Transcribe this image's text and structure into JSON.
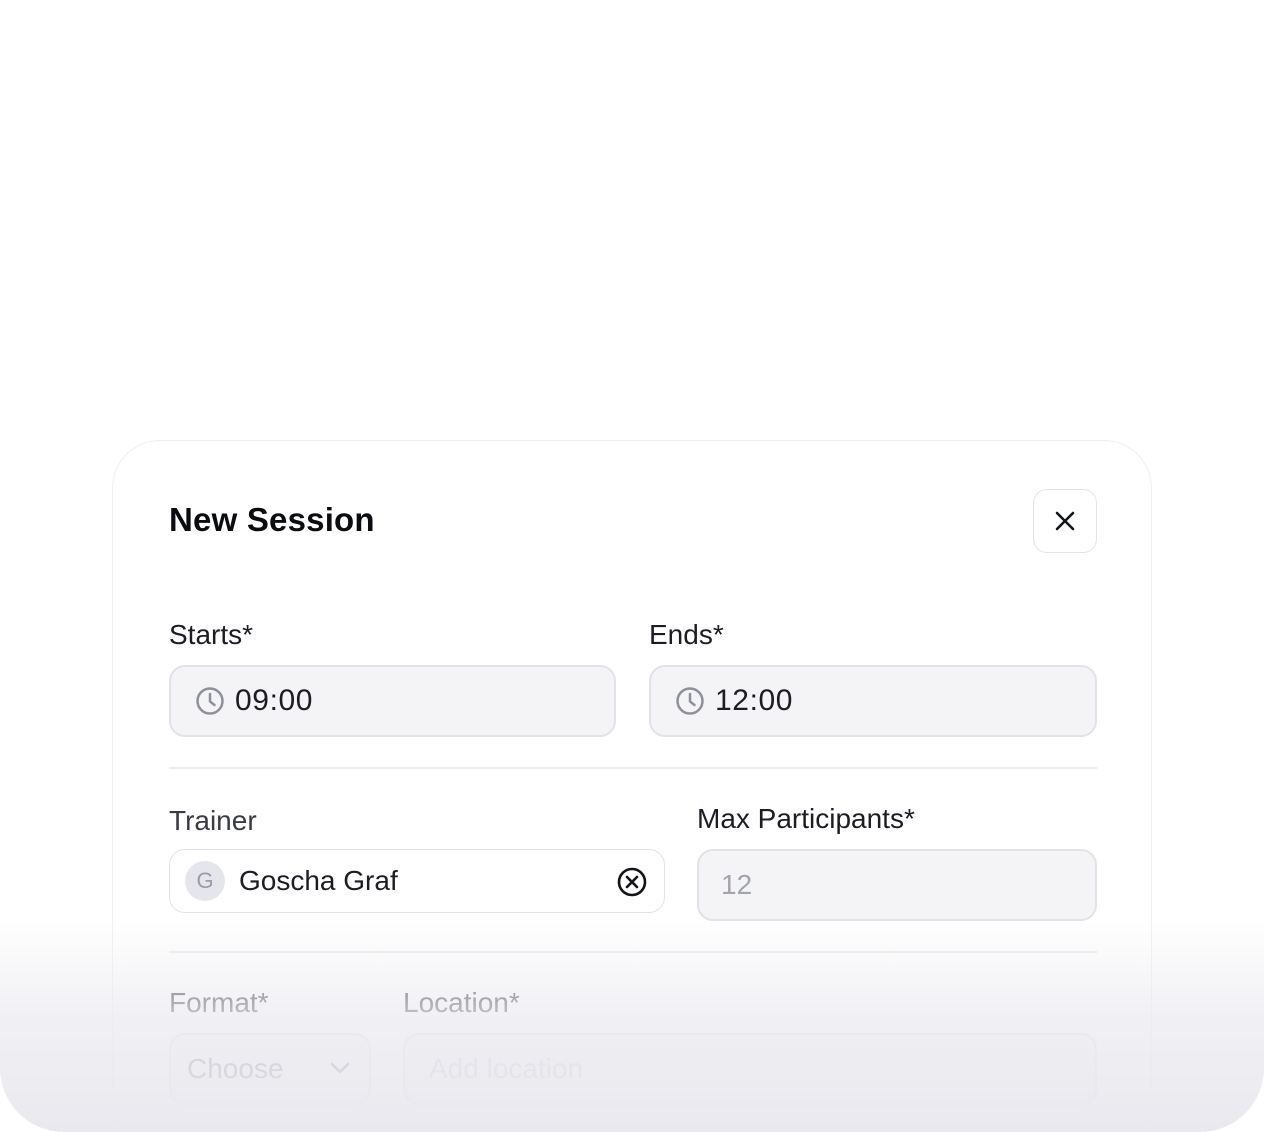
{
  "modal": {
    "title": "New Session",
    "close_icon": "close-icon"
  },
  "fields": {
    "starts": {
      "label": "Starts*",
      "value": "09:00",
      "icon": "clock-icon"
    },
    "ends": {
      "label": "Ends*",
      "value": "12:00",
      "icon": "clock-icon"
    },
    "trainer": {
      "label": "Trainer",
      "avatar_initial": "G",
      "value": "Goscha Graf",
      "clear_icon": "clear-circle-icon"
    },
    "max_participants": {
      "label": "Max Participants*",
      "placeholder": "12"
    },
    "format": {
      "label": "Format*",
      "placeholder": "Choose",
      "icon": "chevron-down-icon"
    },
    "location": {
      "label": "Location*",
      "placeholder": "Add location"
    }
  }
}
